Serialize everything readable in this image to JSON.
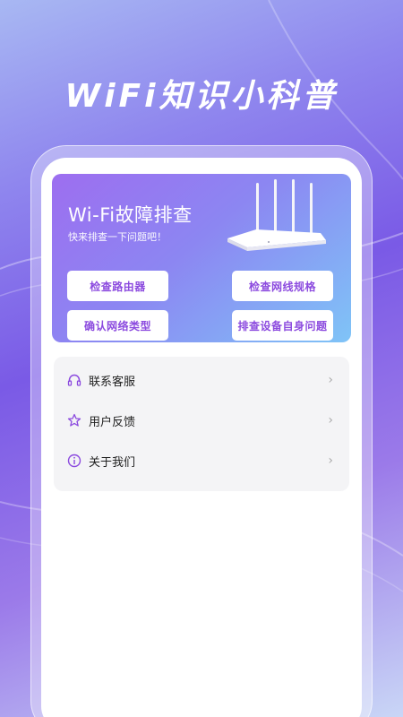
{
  "hero": {
    "title": "WiFi知识小科普"
  },
  "banner": {
    "title": "Wi-Fi故障排查",
    "subtitle": "快来排查一下问题吧！",
    "buttons": [
      {
        "label": "检查路由器"
      },
      {
        "label": "检查网线规格"
      },
      {
        "label": "确认网络类型"
      },
      {
        "label": "排查设备自身问题"
      }
    ]
  },
  "menu": {
    "items": [
      {
        "label": "联系客服",
        "icon": "headphones-icon"
      },
      {
        "label": "用户反馈",
        "icon": "star-icon"
      },
      {
        "label": "关于我们",
        "icon": "info-icon"
      }
    ],
    "chevron": "›"
  },
  "colors": {
    "accent": "#8c4bdf",
    "banner_start": "#9d6ef0",
    "banner_end": "#7fc4f7"
  }
}
